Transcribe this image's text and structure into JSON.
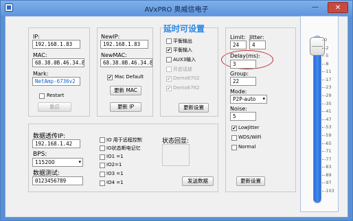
{
  "window": {
    "title": "AVxPRO 奥威信电子",
    "min_label": "—",
    "close_label": "✕"
  },
  "annotation": "延时可设置",
  "network_current": {
    "ip_label": "IP:",
    "ip_value": "192.168.1.83",
    "mac_label": "MAC:",
    "mac_value": "68.38.0B.46.34.8E",
    "mark_label": "Mark:",
    "mark_value": "NetAmp-6736v2",
    "restart_label": "Restart",
    "restart_checked": "",
    "reboot_button": "重启"
  },
  "network_new": {
    "ip_label": "NewIP:",
    "ip_value": "192.168.1.83",
    "mac_label": "NewMAC:",
    "mac_value": "68.38.0B.46.34.8E",
    "mac_default_label": "Mac Default",
    "mac_default_checked": "✔",
    "update_mac_button": "更新 MAC",
    "update_ip_button": "更新 IP"
  },
  "modes": {
    "items": [
      {
        "label": "平衡输出",
        "checked": "",
        "disabled": false
      },
      {
        "label": "平衡输入",
        "checked": "✔",
        "disabled": false
      },
      {
        "label": "AUX3输入",
        "checked": "",
        "disabled": false
      },
      {
        "label": "开启话放",
        "checked": "",
        "disabled": true
      },
      {
        "label": "Demo6702",
        "checked": "✔",
        "disabled": true
      },
      {
        "label": "Demo6762",
        "checked": "✔",
        "disabled": true
      }
    ],
    "update_button": "更新设置"
  },
  "params": {
    "limit_label": "Limit:",
    "limit_value": "24",
    "jitter_label": "Jitter:",
    "jitter_value": "4",
    "delay_label": "Delay(ms):",
    "delay_value": "3",
    "group_label": "Group:",
    "group_value": "22",
    "mode_label": "Mode:",
    "mode_value": "P2P-auto",
    "noise_label": "Noise:",
    "noise_value": "5",
    "options": [
      {
        "label": "LowJitter",
        "checked": "✔"
      },
      {
        "label": "WDS/WiFi",
        "checked": ""
      },
      {
        "label": "Normal",
        "checked": ""
      }
    ],
    "update_button": "更新设置"
  },
  "serial": {
    "pass_ip_label": "数据透传IP:",
    "pass_ip_value": "192.168.1.42",
    "bps_label": "BPS:",
    "bps_value": "115200",
    "test_label": "数据测试:",
    "test_value": "0123456789",
    "io_items": [
      {
        "label": "IO 用于远程控制",
        "checked": ""
      },
      {
        "label": "IO状态断电记忆",
        "checked": ""
      },
      {
        "label": "IO1 =1",
        "checked": ""
      },
      {
        "label": "IO2=1",
        "checked": ""
      },
      {
        "label": "IO3 =1",
        "checked": ""
      },
      {
        "label": "IO4 =1",
        "checked": ""
      }
    ],
    "status_label": "状态回显:",
    "send_button": "发送数据"
  },
  "volume": {
    "level": 0.93,
    "ticks": [
      "0",
      "-2",
      "-5",
      "-8",
      "-11",
      "-17",
      "-23",
      "-29",
      "-35",
      "-41",
      "-47",
      "-53",
      "-59",
      "-65",
      "-71",
      "-77",
      "-83",
      "-89",
      "-97",
      "-103"
    ],
    "colors": {
      "fill": "#3f8bf0",
      "annotation": "#2a88e8",
      "highlight": "#c0282c"
    }
  }
}
